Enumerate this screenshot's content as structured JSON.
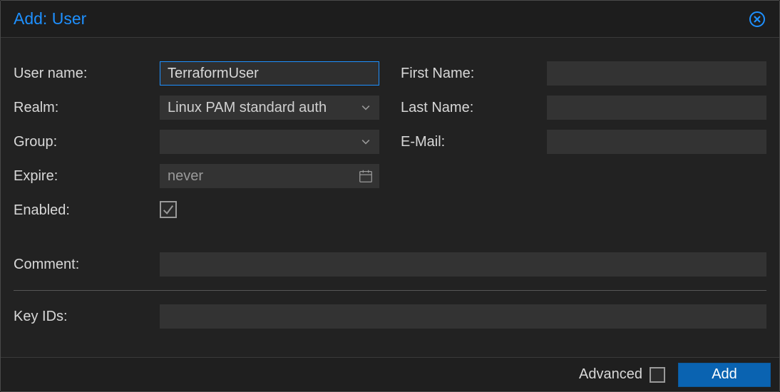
{
  "window": {
    "title": "Add: User"
  },
  "fields": {
    "username": {
      "label": "User name:",
      "value": "TerraformUser"
    },
    "realm": {
      "label": "Realm:",
      "value": "Linux PAM standard auth"
    },
    "group": {
      "label": "Group:",
      "value": ""
    },
    "expire": {
      "label": "Expire:",
      "placeholder": "never",
      "value": ""
    },
    "enabled": {
      "label": "Enabled:",
      "checked": true
    },
    "firstname": {
      "label": "First Name:",
      "value": ""
    },
    "lastname": {
      "label": "Last Name:",
      "value": ""
    },
    "email": {
      "label": "E-Mail:",
      "value": ""
    },
    "comment": {
      "label": "Comment:",
      "value": ""
    },
    "keyids": {
      "label": "Key IDs:",
      "value": ""
    }
  },
  "footer": {
    "advanced_label": "Advanced",
    "advanced_checked": false,
    "add_label": "Add"
  },
  "colors": {
    "accent": "#1e90ff",
    "button_bg": "#0a63b1"
  }
}
